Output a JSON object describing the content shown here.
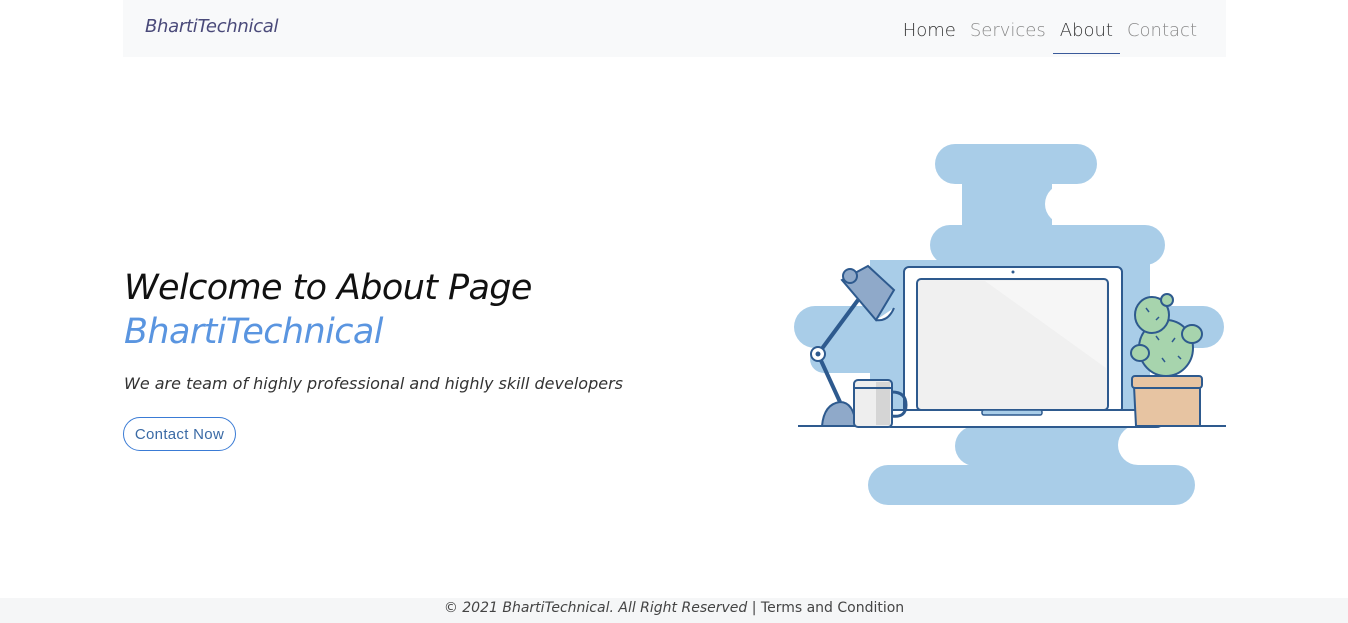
{
  "navbar": {
    "brand": "BhartiTechnical",
    "links": [
      {
        "label": "Home"
      },
      {
        "label": "Services"
      },
      {
        "label": "About"
      },
      {
        "label": "Contact"
      }
    ]
  },
  "hero": {
    "title": "Welcome to About Page",
    "brand": "BhartiTechnical",
    "subtitle": "We are team of highly professional and highly skill developers",
    "button_label": "Contact Now"
  },
  "illustration": {
    "icon": "desk-workspace-illustration",
    "blob_color": "#a9cde8",
    "outline_color": "#2e5a8e"
  },
  "footer": {
    "copyright": "© 2021 BhartiTechnical. All Right Reserved |",
    "terms": "Terms and Condition"
  },
  "colors": {
    "accent": "#5a95e0",
    "button_border": "#3a7bd5",
    "navbar_bg": "#f8f9fa"
  }
}
